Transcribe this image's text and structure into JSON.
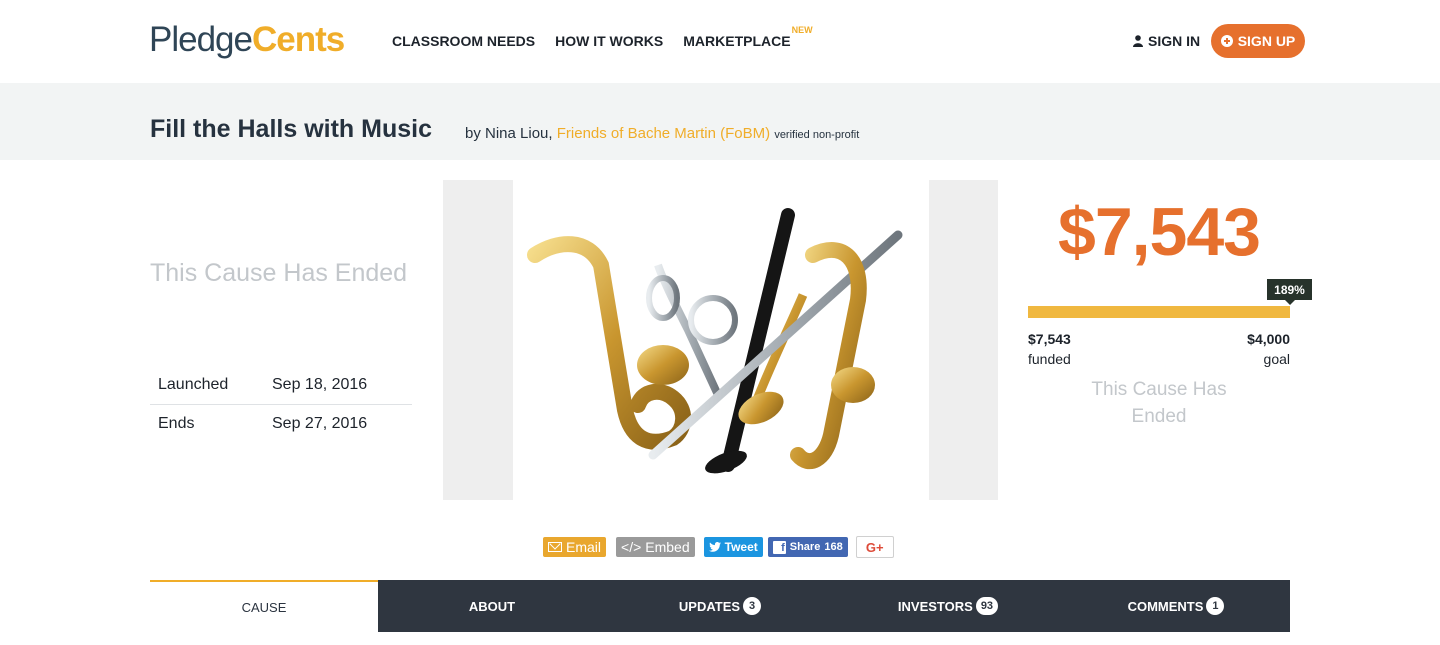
{
  "header": {
    "logo_part1": "Pledge",
    "logo_part2": "Cents",
    "nav": [
      {
        "label": "CLASSROOM NEEDS"
      },
      {
        "label": "HOW IT WORKS"
      },
      {
        "label": "MARKETPLACE",
        "badge": "NEW"
      }
    ],
    "signin_label": "SIGN IN",
    "signup_label": "SIGN UP"
  },
  "cause": {
    "title": "Fill the Halls with Music",
    "by_prefix": "by Nina Liou, ",
    "organization": "Friends of Bache Martin (FoBM)",
    "verified": "verified non-profit",
    "status": "This Cause Has Ended",
    "launched_label": "Launched",
    "launched_date": "Sep 18, 2016",
    "ends_label": "Ends",
    "ends_date": "Sep 27, 2016"
  },
  "funding": {
    "amount": "$7,543",
    "percent_label": "189%",
    "progress_fraction": 1.0,
    "funded_value": "$7,543",
    "funded_label": "funded",
    "goal_value": "$4,000",
    "goal_label": "goal",
    "status": "This Cause Has Ended"
  },
  "share": {
    "email": "Email",
    "embed": "Embed",
    "tweet": "Tweet",
    "share": "Share",
    "share_count": "168",
    "gplus": "G+"
  },
  "tabs": [
    {
      "label": "CAUSE",
      "badge": ""
    },
    {
      "label": "ABOUT",
      "badge": ""
    },
    {
      "label": "UPDATES",
      "badge": "3"
    },
    {
      "label": "INVESTORS",
      "badge": "93"
    },
    {
      "label": "COMMENTS",
      "badge": "1"
    }
  ],
  "colors": {
    "accent_orange": "#e6702d",
    "accent_yellow": "#f0ad29",
    "tab_bar": "#2f3640"
  }
}
